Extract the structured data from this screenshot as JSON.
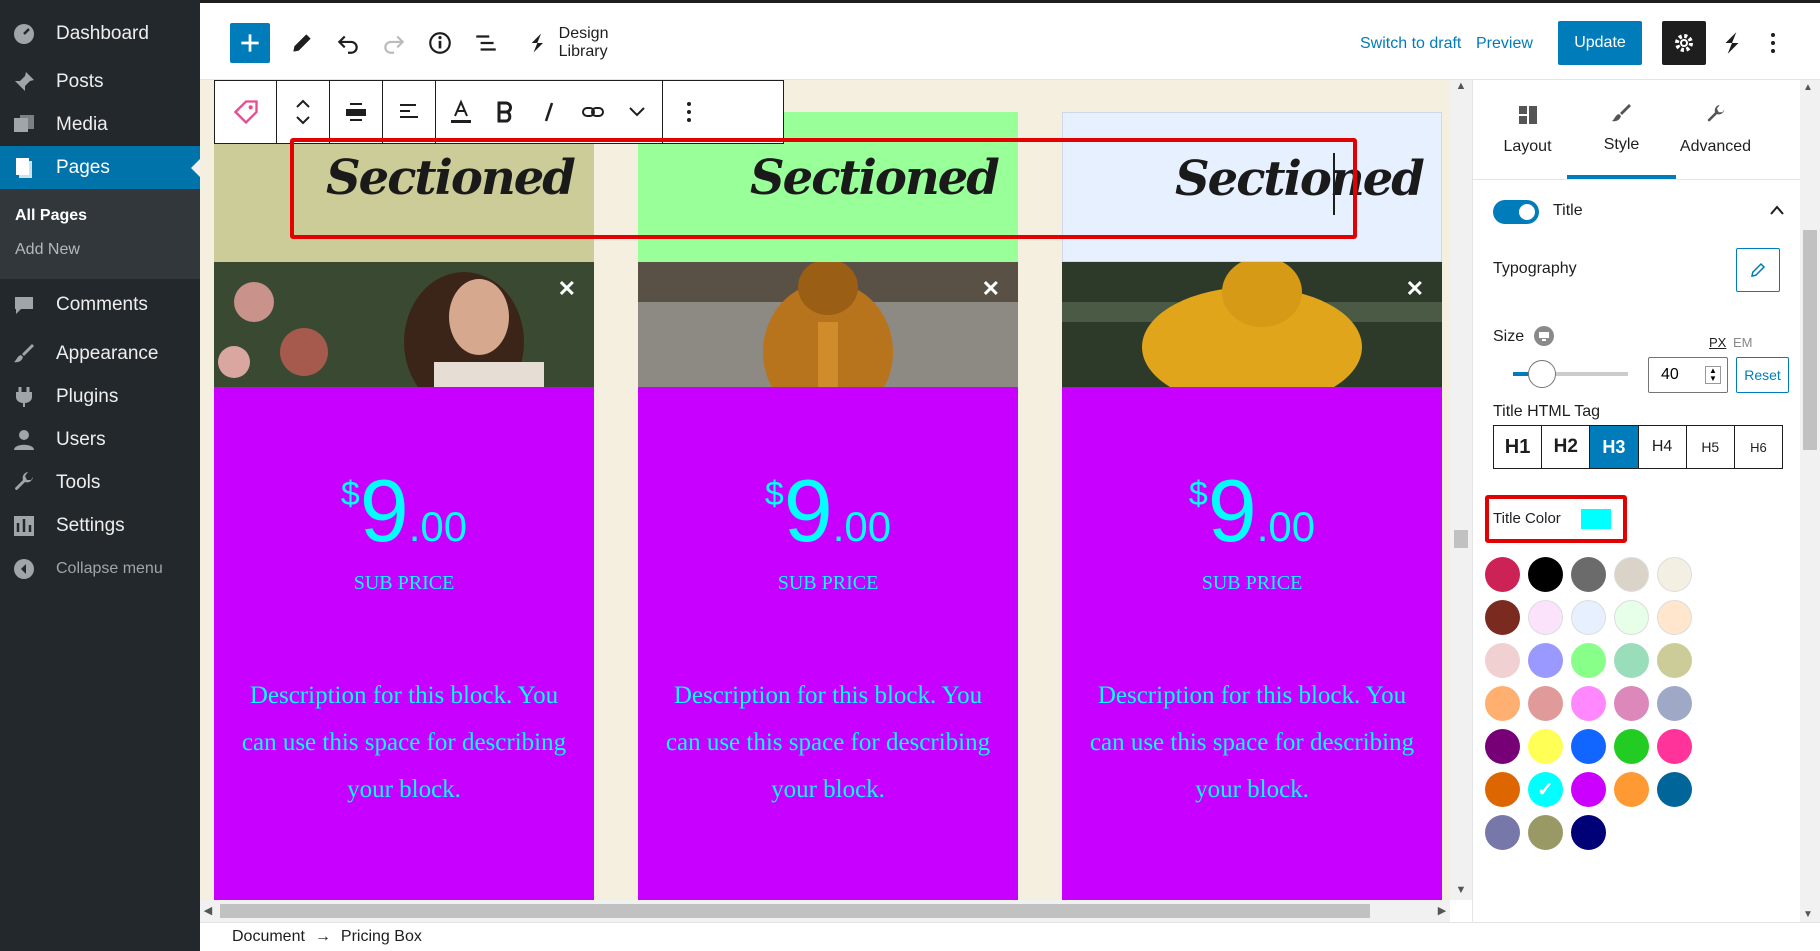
{
  "sidebar": {
    "items": [
      {
        "label": "Dashboard",
        "icon": "dashboard-icon"
      },
      {
        "label": "Posts",
        "icon": "pin-icon"
      },
      {
        "label": "Media",
        "icon": "media-icon"
      },
      {
        "label": "Pages",
        "icon": "pages-icon"
      },
      {
        "label": "Comments",
        "icon": "comment-icon"
      },
      {
        "label": "Appearance",
        "icon": "brush-icon"
      },
      {
        "label": "Plugins",
        "icon": "plugin-icon"
      },
      {
        "label": "Users",
        "icon": "user-icon"
      },
      {
        "label": "Tools",
        "icon": "wrench-icon"
      },
      {
        "label": "Settings",
        "icon": "settings-icon"
      }
    ],
    "submenu": [
      "All Pages",
      "Add New"
    ],
    "collapse_label": "Collapse menu"
  },
  "topbar": {
    "design_library": "Design Library",
    "switch_to_draft": "Switch to draft",
    "preview": "Preview",
    "update": "Update"
  },
  "cards": [
    {
      "title": "Sectioned",
      "head_color": "#cccc99",
      "currency": "$",
      "amount": "9",
      "cents": ".00",
      "sub_price": "SUB PRICE",
      "description": "Description for this block. You can use this space for describing your block."
    },
    {
      "title": "Sectioned",
      "head_color": "#99ff99",
      "currency": "$",
      "amount": "9",
      "cents": ".00",
      "sub_price": "SUB PRICE",
      "description": "Description for this block. You can use this space for describing your block."
    },
    {
      "title": "Sectioned",
      "head_color": "#e6f0ff",
      "currency": "$",
      "amount": "9",
      "cents": ".00",
      "sub_price": "SUB PRICE",
      "description": "Description for this block. You can use this space for describing your block."
    }
  ],
  "breadcrumb": {
    "document": "Document",
    "arrow": "→",
    "block": "Pricing Box"
  },
  "panel": {
    "tabs": [
      {
        "label": "Layout",
        "icon": "layout-icon"
      },
      {
        "label": "Style",
        "icon": "brush-icon"
      },
      {
        "label": "Advanced",
        "icon": "wrench-icon"
      }
    ],
    "active_tab": "Style",
    "section_title": "Title",
    "typography": "Typography",
    "size_label": "Size",
    "size_value": "40",
    "unit_px": "PX",
    "unit_em": "EM",
    "reset": "Reset",
    "html_tag_label": "Title HTML Tag",
    "html_tags": [
      "H1",
      "H2",
      "H3",
      "H4",
      "H5",
      "H6"
    ],
    "active_tag": "H3",
    "title_color_label": "Title Color",
    "title_color": "#00ffff",
    "palette": [
      [
        "#cc2255",
        "#000000",
        "#6b6b6b",
        "#d9d4c7",
        "#f3efe2"
      ],
      [
        "#7a2a1f",
        "#fbe3fb",
        "#e6f0ff",
        "#e6ffe6",
        "#ffe6cc"
      ],
      [
        "#f0d0d0",
        "#9999ff",
        "#88ff88",
        "#99ddbb",
        "#cccc99"
      ],
      [
        "#ffb070",
        "#e09a9a",
        "#ff88ff",
        "#dd88bb",
        "#a0a8c8"
      ],
      [
        "#770077",
        "#ffff55",
        "#1166ff",
        "#22cc22",
        "#ff3399"
      ],
      [
        "#dd6600",
        "#00ffff",
        "#cc00ff",
        "#ff9933",
        "#006699"
      ],
      [
        "#7777aa",
        "#999966",
        "#000077"
      ]
    ]
  }
}
